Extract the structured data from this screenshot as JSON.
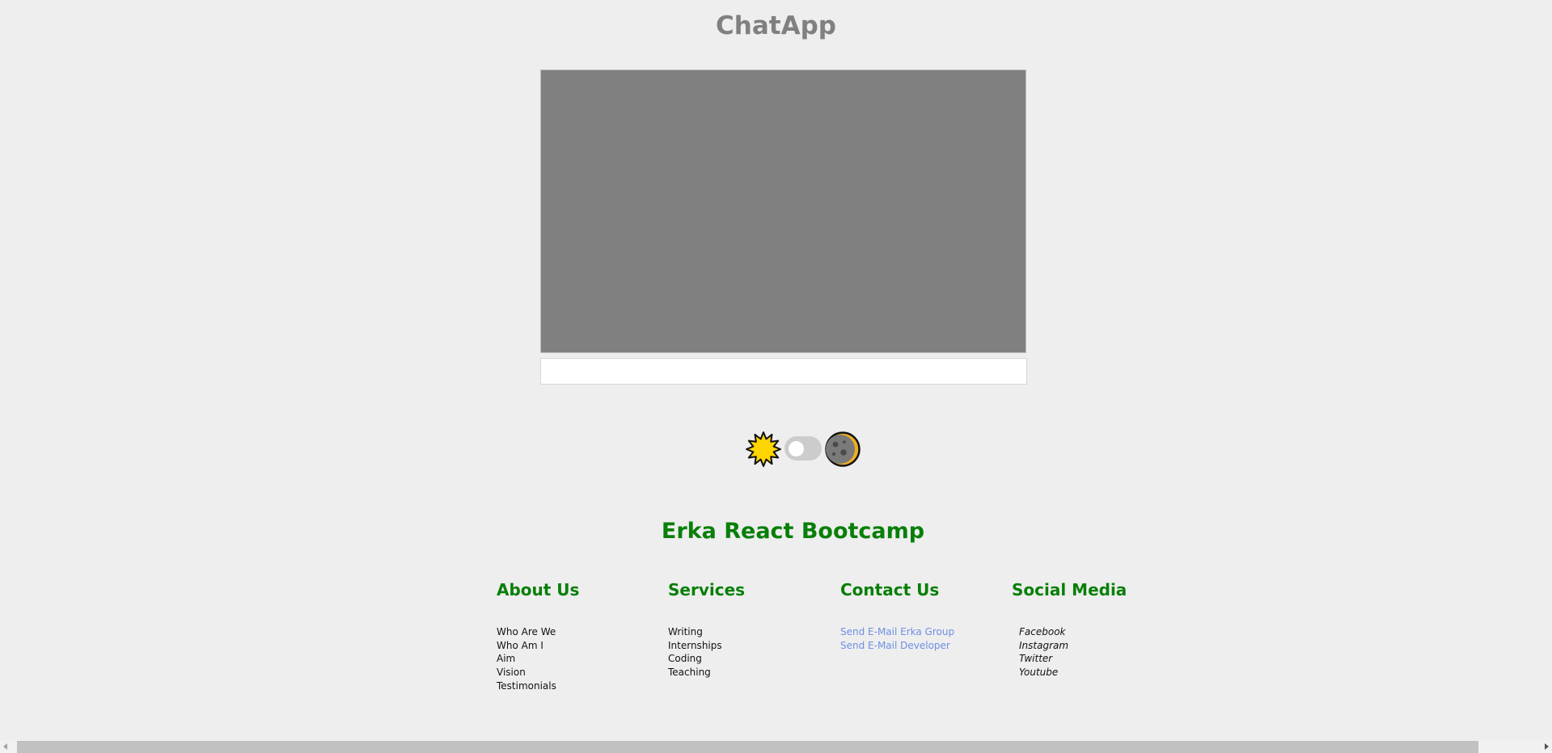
{
  "app": {
    "title": "ChatApp"
  },
  "chat": {
    "input_value": "",
    "input_placeholder": ""
  },
  "theme": {
    "light_icon": "sun-icon",
    "dark_icon": "moon-icon",
    "mode": "light",
    "toggle_on": false
  },
  "footer": {
    "title": "Erka React Bootcamp",
    "columns": [
      {
        "heading": "About Us",
        "links": [
          "Who Are We",
          "Who Am I",
          "Aim",
          "Vision",
          "Testimonials"
        ]
      },
      {
        "heading": "Services",
        "links": [
          "Writing",
          "Internships",
          "Coding",
          "Teaching"
        ]
      },
      {
        "heading": "Contact Us",
        "links": [
          "Send E-Mail Erka Group",
          "Send E-Mail Developer"
        ]
      },
      {
        "heading": "Social Media",
        "links": [
          "Facebook",
          "Instagram",
          "Twitter",
          "Youtube"
        ]
      }
    ]
  },
  "colors": {
    "background": "#eeeeee",
    "title_gray": "#808080",
    "chat_panel": "#808080",
    "footer_green": "#087f08",
    "contact_link_blue": "#6f8fe3",
    "sun_yellow": "#ffd500",
    "moon_gray": "#7a7a7a"
  }
}
